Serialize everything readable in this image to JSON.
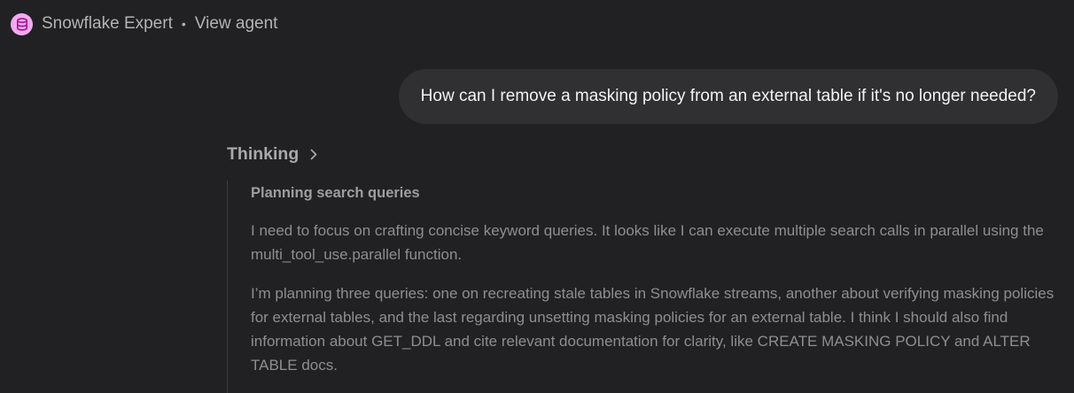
{
  "header": {
    "agent_name": "Snowflake Expert",
    "separator": "•",
    "view_agent_label": "View agent",
    "agent_icon": "database-icon",
    "agent_icon_bg": "#f3a9f0",
    "agent_icon_color": "#a4168f"
  },
  "user_message": {
    "text": "How can I remove a masking policy from an external table if it's no longer needed?"
  },
  "thinking": {
    "label": "Thinking",
    "icon": "chevron-right-icon",
    "step_title": "Planning search queries",
    "paragraphs": [
      "I need to focus on crafting concise keyword queries. It looks like I can execute multiple search calls in parallel using the multi_tool_use.parallel function.",
      "I’m planning three queries: one on recreating stale tables in Snowflake streams, another about verifying masking policies for external tables, and the last regarding unsetting masking policies for an external table. I think I should also find information about GET_DDL and cite relevant documentation for clarity, like CREATE MASKING POLICY and ALTER TABLE docs."
    ]
  }
}
